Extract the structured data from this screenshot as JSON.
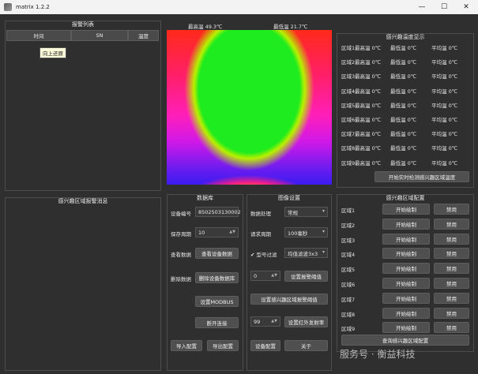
{
  "window": {
    "title": "matrix 1.2.2",
    "min": "—",
    "max": "☐",
    "close": "✕"
  },
  "alarm_list": {
    "title": "报警列表",
    "columns": [
      "时间",
      "SN",
      "温度"
    ],
    "tooltip": "向上还原"
  },
  "roi_alarm": {
    "title": "感兴趣区域报警消息"
  },
  "thermal": {
    "max_label": "最高温 49.3℃",
    "min_label": "最低温 21.7℃"
  },
  "roi_temp": {
    "title": "感兴趣温度显示",
    "rows": [
      {
        "area": "区域1",
        "max": "最高温 0℃",
        "min": "最低温 0℃",
        "avg": "平均温 0℃"
      },
      {
        "area": "区域2",
        "max": "最高温 0℃",
        "min": "最低温 0℃",
        "avg": "平均温 0℃"
      },
      {
        "area": "区域3",
        "max": "最高温 0℃",
        "min": "最低温 0℃",
        "avg": "平均温 0℃"
      },
      {
        "area": "区域4",
        "max": "最高温 0℃",
        "min": "最低温 0℃",
        "avg": "平均温 0℃"
      },
      {
        "area": "区域5",
        "max": "最高温 0℃",
        "min": "最低温 0℃",
        "avg": "平均温 0℃"
      },
      {
        "area": "区域6",
        "max": "最高温 0℃",
        "min": "最低温 0℃",
        "avg": "平均温 0℃"
      },
      {
        "area": "区域7",
        "max": "最高温 0℃",
        "min": "最低温 0℃",
        "avg": "平均温 0℃"
      },
      {
        "area": "区域8",
        "max": "最高温 0℃",
        "min": "最低温 0℃",
        "avg": "平均温 0℃"
      },
      {
        "area": "区域9",
        "max": "最高温 0℃",
        "min": "最低温 0℃",
        "avg": "平均温 0℃"
      }
    ],
    "start_button": "开始实时检测感兴趣区域温度"
  },
  "database": {
    "title": "数据库",
    "device_no_label": "设备编号",
    "device_no_value": "8502503130002",
    "save_period_label": "保存周期",
    "save_period_value": "10",
    "view_data_label": "查看数据",
    "view_data_button": "查看设备数据",
    "delete_data_label": "删除数据",
    "delete_data_button": "删除设备数据库",
    "modbus_button": "设置MODBUS",
    "disconnect_button": "断开连接",
    "import_button": "导入配置",
    "export_button": "导出配置"
  },
  "image_settings": {
    "title": "图像设置",
    "data_process_label": "数据处理",
    "data_process_value": "常规",
    "request_period_label": "请求周期",
    "request_period_value": "100毫秒",
    "filter_check": "✔",
    "filter_label": "型号过滤",
    "filter_value": "均值滤波3x3",
    "alarm_threshold_value": "0",
    "alarm_threshold_button": "设置报警阈值",
    "roi_threshold_button": "设置感兴趣区域报警阈值",
    "emissivity_value": "99",
    "emissivity_button": "设置红外发射率",
    "device_config_button": "设备配置",
    "about_button": "关于"
  },
  "roi_config": {
    "title": "感兴趣区域配置",
    "rows": [
      {
        "area": "区域1",
        "draw": "开始绘制",
        "disable": "禁用"
      },
      {
        "area": "区域2",
        "draw": "开始绘制",
        "disable": "禁用"
      },
      {
        "area": "区域3",
        "draw": "开始绘制",
        "disable": "禁用"
      },
      {
        "area": "区域4",
        "draw": "开始绘制",
        "disable": "禁用"
      },
      {
        "area": "区域5",
        "draw": "开始绘制",
        "disable": "禁用"
      },
      {
        "area": "区域6",
        "draw": "开始绘制",
        "disable": "禁用"
      },
      {
        "area": "区域7",
        "draw": "开始绘制",
        "disable": "禁用"
      },
      {
        "area": "区域8",
        "draw": "开始绘制",
        "disable": "禁用"
      },
      {
        "area": "区域9",
        "draw": "开始绘制",
        "disable": "禁用"
      }
    ],
    "query_button": "查询感兴趣区域配置",
    "bottom_partial": "…"
  },
  "watermark": "服务号 · 衡益科技"
}
